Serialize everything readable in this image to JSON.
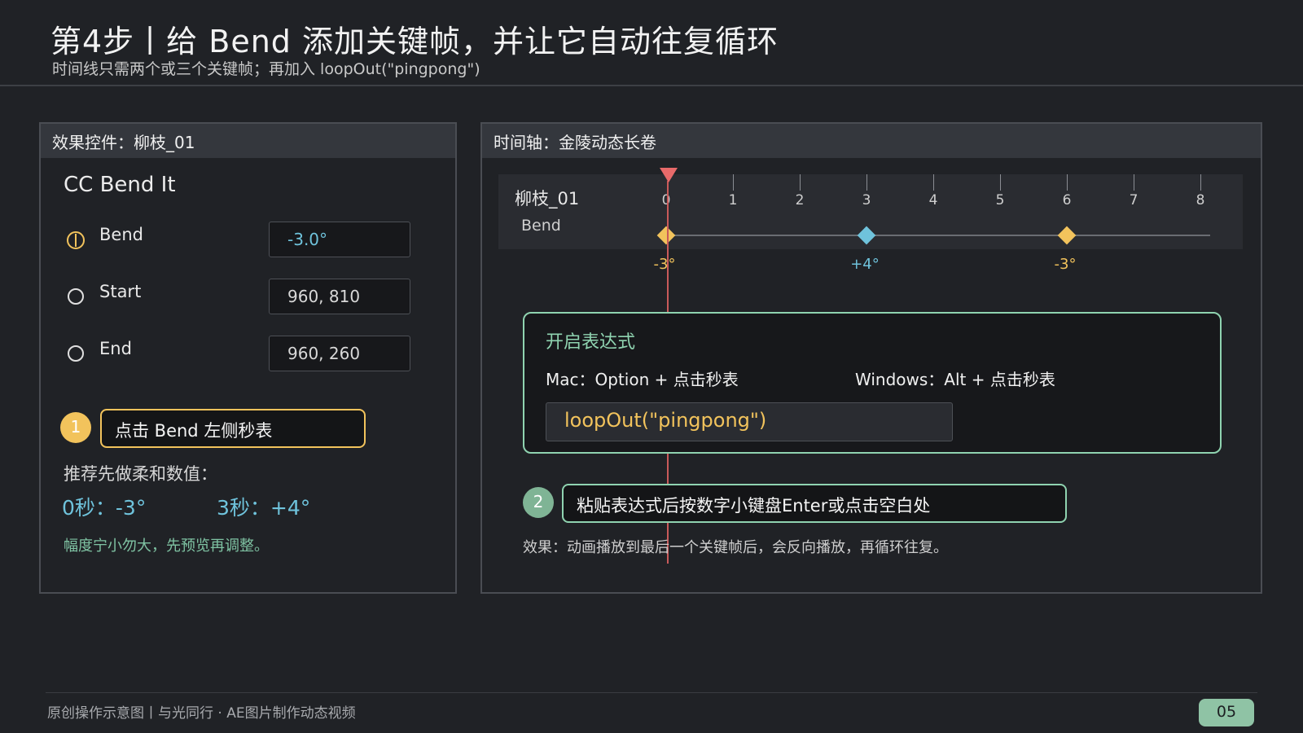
{
  "header": {
    "title": "第4步丨给 Bend 添加关键帧，并让它自动往复循环",
    "subtitle": "时间线只需两个或三个关键帧；再加入 loopOut(\"pingpong\")"
  },
  "effect_panel": {
    "header": "效果控件：柳枝_01",
    "effect_name": "CC Bend It",
    "params": [
      {
        "label": "Bend",
        "value": "-3.0°",
        "icon": "stopwatch-icon"
      },
      {
        "label": "Start",
        "value": "960, 810",
        "icon": "radio-icon"
      },
      {
        "label": "End",
        "value": "960, 260",
        "icon": "radio-icon"
      }
    ],
    "step1": {
      "num": "1",
      "text": "点击 Bend 左侧秒表"
    },
    "recommend_head": "推荐先做柔和数值：",
    "recommend_values": [
      "0秒：-3°",
      "3秒：+4°"
    ],
    "note": "幅度宁小勿大，先预览再调整。"
  },
  "timeline_panel": {
    "header": "时间轴：金陵动态长卷",
    "layer_name": "柳枝_01",
    "property": "Bend",
    "ticks": [
      "0",
      "1",
      "2",
      "3",
      "4",
      "5",
      "6",
      "7",
      "8"
    ],
    "keyframes": [
      {
        "time": 0,
        "label": "-3°",
        "color": "#f2c35c"
      },
      {
        "time": 3,
        "label": "+4°",
        "color": "#6fc3dc"
      },
      {
        "time": 6,
        "label": "-3°",
        "color": "#f2c35c"
      }
    ],
    "expression": {
      "title": "开启表达式",
      "mac": "Mac：Option + 点击秒表",
      "windows": "Windows：Alt + 点击秒表",
      "code": "loopOut(\"pingpong\")"
    },
    "step2": {
      "num": "2",
      "text": "粘贴表达式后按数字小键盘Enter或点击空白处"
    },
    "result": "效果：动画播放到最后一个关键帧后，会反向播放，再循环往复。"
  },
  "footer": {
    "text": "原创操作示意图丨与光同行 ·  AE图片制作动态视频",
    "page": "05"
  },
  "colors": {
    "accent_yellow": "#f2c35c",
    "accent_blue": "#6fc3dc",
    "accent_green": "#8fd3b0",
    "playhead": "#e86a6a"
  }
}
